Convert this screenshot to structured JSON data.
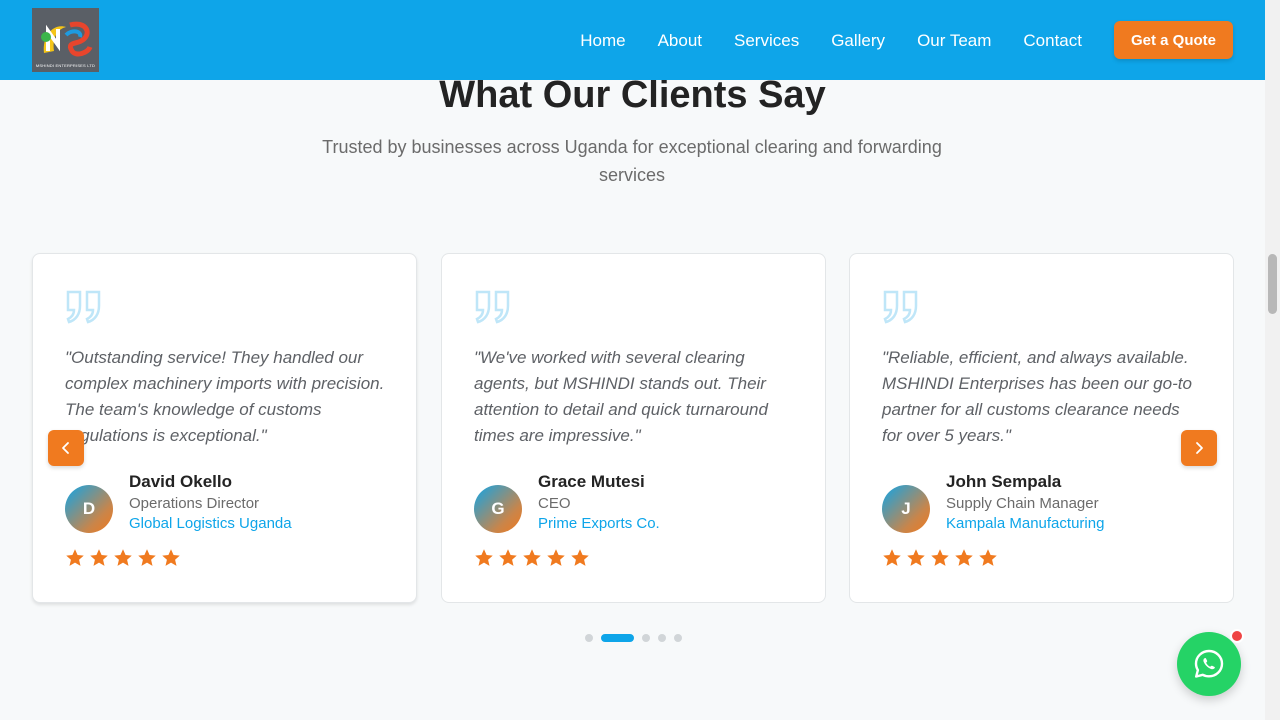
{
  "header": {
    "logo_text": "MSHINDI ENTERPRISES LTD",
    "nav": [
      "Home",
      "About",
      "Services",
      "Gallery",
      "Our Team",
      "Contact"
    ],
    "cta_label": "Get a Quote",
    "brand_color": "#0ea5e9",
    "accent_color": "#f07a1f"
  },
  "testimonials": {
    "title": "What Our Clients Say",
    "subtitle": "Trusted by businesses across Uganda for exceptional clearing and forwarding services",
    "cards": [
      {
        "quote": "\"Outstanding service! They handled our complex machinery imports with precision. The team's knowledge of customs regulations is exceptional.\"",
        "initial": "D",
        "name": "David Okello",
        "role": "Operations Director",
        "company": "Global Logistics Uganda",
        "rating": 5
      },
      {
        "quote": "\"We've worked with several clearing agents, but MSHINDI stands out. Their attention to detail and quick turnaround times are impressive.\"",
        "initial": "G",
        "name": "Grace Mutesi",
        "role": "CEO",
        "company": "Prime Exports Co.",
        "rating": 5
      },
      {
        "quote": "\"Reliable, efficient, and always available. MSHINDI Enterprises has been our go-to partner for all customs clearance needs for over 5 years.\"",
        "initial": "J",
        "name": "John Sempala",
        "role": "Supply Chain Manager",
        "company": "Kampala Manufacturing",
        "rating": 5
      }
    ],
    "prev_icon": "chevron-left-icon",
    "next_icon": "chevron-right-icon",
    "dots_total": 5,
    "active_dot": 2
  },
  "chat": {
    "icon": "whatsapp-icon",
    "badge_color": "#ef4444"
  }
}
